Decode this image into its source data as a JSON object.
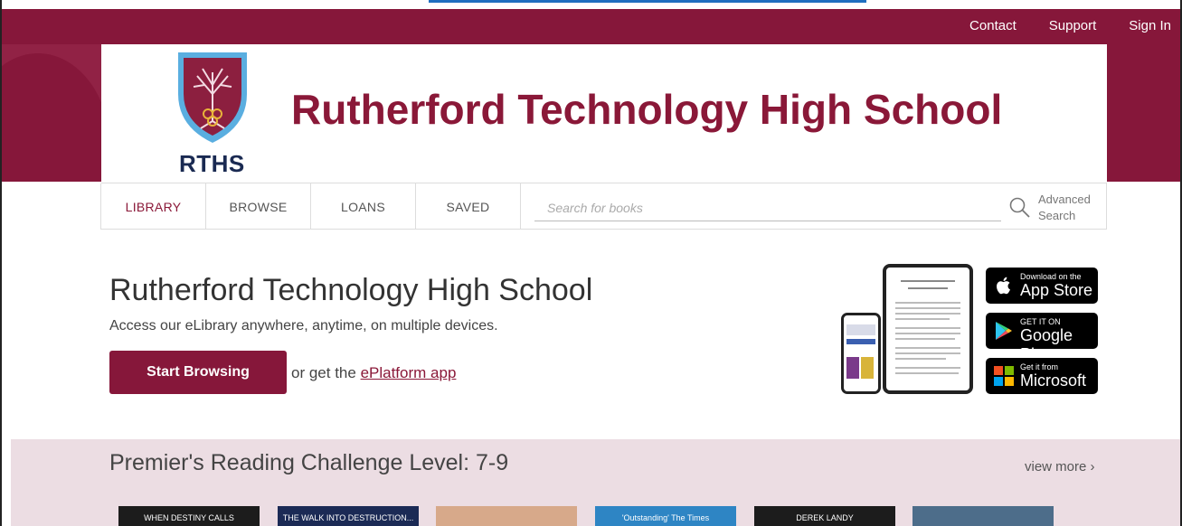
{
  "topbar": {
    "links": [
      "Contact",
      "Support",
      "Sign In"
    ]
  },
  "banner": {
    "crest_text": "RTHS",
    "title": "Rutherford Technology High School"
  },
  "nav": {
    "tabs": [
      "LIBRARY",
      "BROWSE",
      "LOANS",
      "SAVED"
    ],
    "active_tab": "LIBRARY",
    "search_placeholder": "Search for books",
    "advanced_search_line1": "Advanced",
    "advanced_search_line2": "Search"
  },
  "intro": {
    "title": "Rutherford Technology High School",
    "subtitle": "Access our eLibrary anywhere, anytime, on multiple devices.",
    "start_button": "Start Browsing",
    "or_text": "or get the ",
    "app_link": "ePlatform app"
  },
  "stores": [
    {
      "small": "Download on the",
      "big": "App Store",
      "icon": "apple-icon"
    },
    {
      "small": "GET IT ON",
      "big": "Google Play",
      "icon": "google-play-icon"
    },
    {
      "small": "Get it from",
      "big": "Microsoft",
      "icon": "microsoft-icon"
    }
  ],
  "challenge": {
    "title": "Premier's Reading Challenge Level: 7-9",
    "view_more": "view more ›",
    "book_covers": [
      {
        "color": "#1c1c1c",
        "label": "WHEN DESTINY CALLS"
      },
      {
        "color": "#1b2a55",
        "label": "THE WALK INTO DESTRUCTION..."
      },
      {
        "color": "#d7a98a",
        "label": ""
      },
      {
        "color": "#2e85c4",
        "label": "'Outstanding' The Times"
      },
      {
        "color": "#1c1c1c",
        "label": "DEREK LANDY"
      },
      {
        "color": "#4d6d8a",
        "label": ""
      }
    ]
  },
  "colors": {
    "brand": "#86173a",
    "title_text": "#8a1838",
    "crest_navy": "#1a2a52",
    "challenge_bg": "#ecdde3"
  }
}
